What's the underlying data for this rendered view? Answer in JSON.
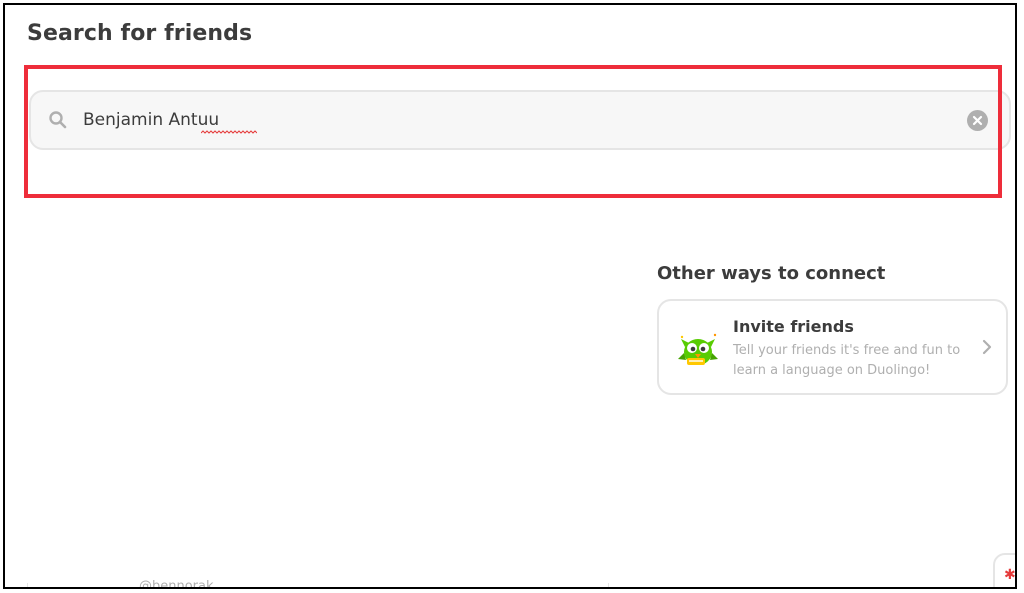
{
  "page": {
    "title": "Search for friends"
  },
  "search": {
    "value": "Benjamin Antuu",
    "icon": "search-icon",
    "clear_icon": "clear-icon"
  },
  "connect": {
    "title": "Other ways to connect",
    "invite": {
      "title": "Invite friends",
      "description": "Tell your friends it's free and fun to learn a language on Duolingo!",
      "icon": "duolingo-owl-icon",
      "chevron_icon": "chevron-right-icon"
    }
  },
  "partial_result": {
    "username": "@bennorak"
  },
  "colors": {
    "highlight": "#ee2d3a",
    "text": "#3c3c3c",
    "muted": "#afafaf",
    "border": "#e5e5e5",
    "owl_green": "#58cc02"
  }
}
